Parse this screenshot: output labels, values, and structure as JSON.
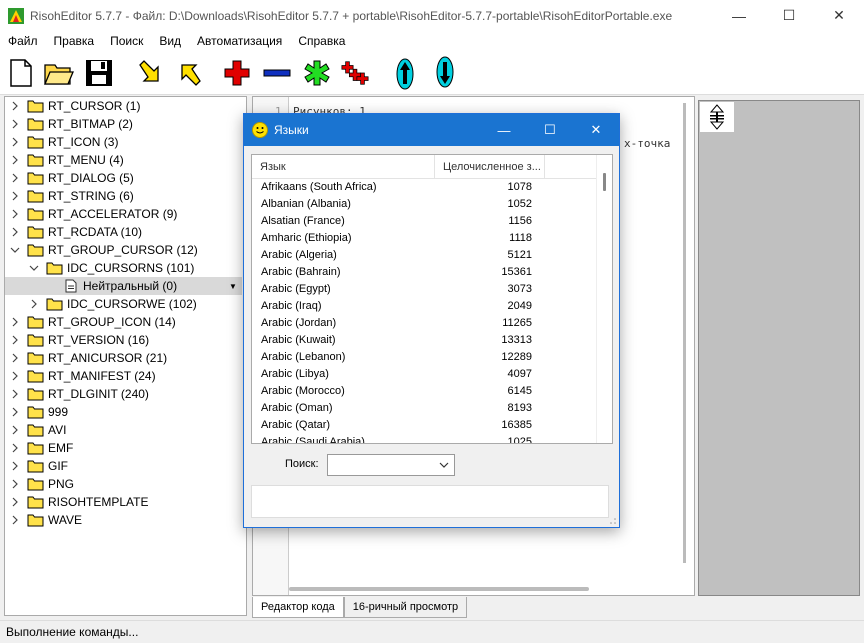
{
  "window": {
    "title": "RisohEditor 5.7.7 - Файл: D:\\Downloads\\RisohEditor 5.7.7 + portable\\RisohEditor-5.7.7-portable\\RisohEditorPortable.exe",
    "minimize": "—",
    "maximize": "☐",
    "close": "✕"
  },
  "menu": [
    "Файл",
    "Правка",
    "Поиск",
    "Вид",
    "Автоматизация",
    "Справка"
  ],
  "toolbar_icons": [
    "new-file-icon",
    "open-folder-icon",
    "save-icon",
    "import-arrow-icon",
    "export-arrow-icon",
    "add-red-plus-icon",
    "remove-blue-minus-icon",
    "green-star-icon",
    "red-plus-multiple-icon",
    "move-up-icon",
    "move-down-icon"
  ],
  "tree": {
    "items": [
      {
        "label": "RT_CURSOR (1)",
        "level": 0,
        "expanded": false
      },
      {
        "label": "RT_BITMAP (2)",
        "level": 0,
        "expanded": false
      },
      {
        "label": "RT_ICON (3)",
        "level": 0,
        "expanded": false
      },
      {
        "label": "RT_MENU (4)",
        "level": 0,
        "expanded": false
      },
      {
        "label": "RT_DIALOG (5)",
        "level": 0,
        "expanded": false
      },
      {
        "label": "RT_STRING (6)",
        "level": 0,
        "expanded": false
      },
      {
        "label": "RT_ACCELERATOR (9)",
        "level": 0,
        "expanded": false
      },
      {
        "label": "RT_RCDATA (10)",
        "level": 0,
        "expanded": false
      },
      {
        "label": "RT_GROUP_CURSOR (12)",
        "level": 0,
        "expanded": true
      },
      {
        "label": "IDC_CURSORNS (101)",
        "level": 1,
        "expanded": true
      },
      {
        "label": "Нейтральный (0)",
        "level": 2,
        "selected": true
      },
      {
        "label": "IDC_CURSORWE (102)",
        "level": 1,
        "expanded": false
      },
      {
        "label": "RT_GROUP_ICON (14)",
        "level": 0,
        "expanded": false
      },
      {
        "label": "RT_VERSION (16)",
        "level": 0,
        "expanded": false
      },
      {
        "label": "RT_ANICURSOR (21)",
        "level": 0,
        "expanded": false
      },
      {
        "label": "RT_MANIFEST (24)",
        "level": 0,
        "expanded": false
      },
      {
        "label": "RT_DLGINIT (240)",
        "level": 0,
        "expanded": false
      },
      {
        "label": "999",
        "level": 0,
        "expanded": false
      },
      {
        "label": "AVI",
        "level": 0,
        "expanded": false
      },
      {
        "label": "EMF",
        "level": 0,
        "expanded": false
      },
      {
        "label": "GIF",
        "level": 0,
        "expanded": false
      },
      {
        "label": "PNG",
        "level": 0,
        "expanded": false
      },
      {
        "label": "RISOHTEMPLATE",
        "level": 0,
        "expanded": false
      },
      {
        "label": "WAVE",
        "level": 0,
        "expanded": false
      }
    ]
  },
  "editor": {
    "line_number": "1",
    "line1": "Рисунков: 1",
    "line2_tail": "х-точка"
  },
  "tabs": [
    {
      "label": "Редактор кода",
      "active": true
    },
    {
      "label": "16-ричный просмотр",
      "active": false
    }
  ],
  "status": "Выполнение команды...",
  "dialog": {
    "title": "Языки",
    "columns": [
      "Язык",
      "Целочисленное з..."
    ],
    "rows": [
      {
        "name": "Afrikaans (South Africa)",
        "value": "1078"
      },
      {
        "name": "Albanian (Albania)",
        "value": "1052"
      },
      {
        "name": "Alsatian (France)",
        "value": "1156"
      },
      {
        "name": "Amharic (Ethiopia)",
        "value": "1118"
      },
      {
        "name": "Arabic (Algeria)",
        "value": "5121"
      },
      {
        "name": "Arabic (Bahrain)",
        "value": "15361"
      },
      {
        "name": "Arabic (Egypt)",
        "value": "3073"
      },
      {
        "name": "Arabic (Iraq)",
        "value": "2049"
      },
      {
        "name": "Arabic (Jordan)",
        "value": "11265"
      },
      {
        "name": "Arabic (Kuwait)",
        "value": "13313"
      },
      {
        "name": "Arabic (Lebanon)",
        "value": "12289"
      },
      {
        "name": "Arabic (Libya)",
        "value": "4097"
      },
      {
        "name": "Arabic (Morocco)",
        "value": "6145"
      },
      {
        "name": "Arabic (Oman)",
        "value": "8193"
      },
      {
        "name": "Arabic (Qatar)",
        "value": "16385"
      },
      {
        "name": "Arabic (Saudi Arabia)",
        "value": "1025"
      }
    ],
    "search_label": "Поиск:",
    "search_value": ""
  },
  "colors": {
    "dialog_title_bg": "#1a74d1",
    "folder_yellow": "#ffe24a",
    "preview_bg": "#c0c0c0"
  }
}
